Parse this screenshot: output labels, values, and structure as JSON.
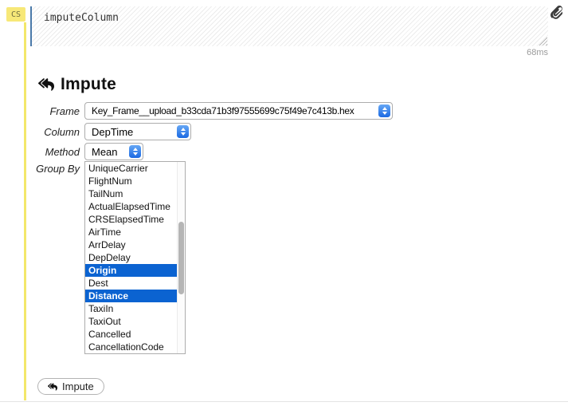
{
  "cell": {
    "badge": "CS",
    "code": "imputeColumn",
    "timing": "68ms",
    "attachment_icon": "paperclip-icon"
  },
  "impute": {
    "title": "Impute",
    "title_icon": "reply-arrow-icon",
    "frame": {
      "label": "Frame",
      "value": "Key_Frame__upload_b33cda71b3f97555699c75f49e7c413b.hex"
    },
    "column": {
      "label": "Column",
      "value": "DepTime"
    },
    "method": {
      "label": "Method",
      "value": "Mean"
    },
    "group_by": {
      "label": "Group By",
      "options": [
        {
          "label": "UniqueCarrier",
          "selected": false
        },
        {
          "label": "FlightNum",
          "selected": false
        },
        {
          "label": "TailNum",
          "selected": false
        },
        {
          "label": "ActualElapsedTime",
          "selected": false
        },
        {
          "label": "CRSElapsedTime",
          "selected": false
        },
        {
          "label": "AirTime",
          "selected": false
        },
        {
          "label": "ArrDelay",
          "selected": false
        },
        {
          "label": "DepDelay",
          "selected": false
        },
        {
          "label": "Origin",
          "selected": true
        },
        {
          "label": "Dest",
          "selected": false
        },
        {
          "label": "Distance",
          "selected": true
        },
        {
          "label": "TaxiIn",
          "selected": false
        },
        {
          "label": "TaxiOut",
          "selected": false
        },
        {
          "label": "Cancelled",
          "selected": false
        },
        {
          "label": "CancellationCode",
          "selected": false
        }
      ]
    },
    "action_button": "Impute"
  },
  "colors": {
    "cell_yellow": "#f3e76a",
    "editor_border_blue": "#4a79a9",
    "selection_blue": "#0b63d1",
    "stepper_blue_top": "#66a7f5",
    "stepper_blue_bottom": "#1b69e2"
  }
}
